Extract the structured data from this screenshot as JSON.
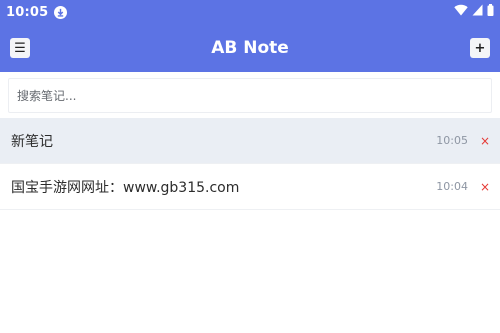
{
  "status_bar": {
    "time": "10:05"
  },
  "header": {
    "title": "AB Note",
    "menu_label": "☰",
    "add_label": "+"
  },
  "search": {
    "placeholder": "搜索笔记..."
  },
  "notes": [
    {
      "title": "新笔记",
      "time": "10:05",
      "delete_label": "×",
      "selected": true
    },
    {
      "title": "国宝手游网网址：www.gb315.com",
      "time": "10:04",
      "delete_label": "×",
      "selected": false
    }
  ],
  "colors": {
    "primary": "#5c73e4",
    "selected_row": "#eaeef4",
    "delete": "#e53935"
  },
  "icons": [
    "download-icon",
    "wifi-icon",
    "signal-icon",
    "battery-icon"
  ]
}
